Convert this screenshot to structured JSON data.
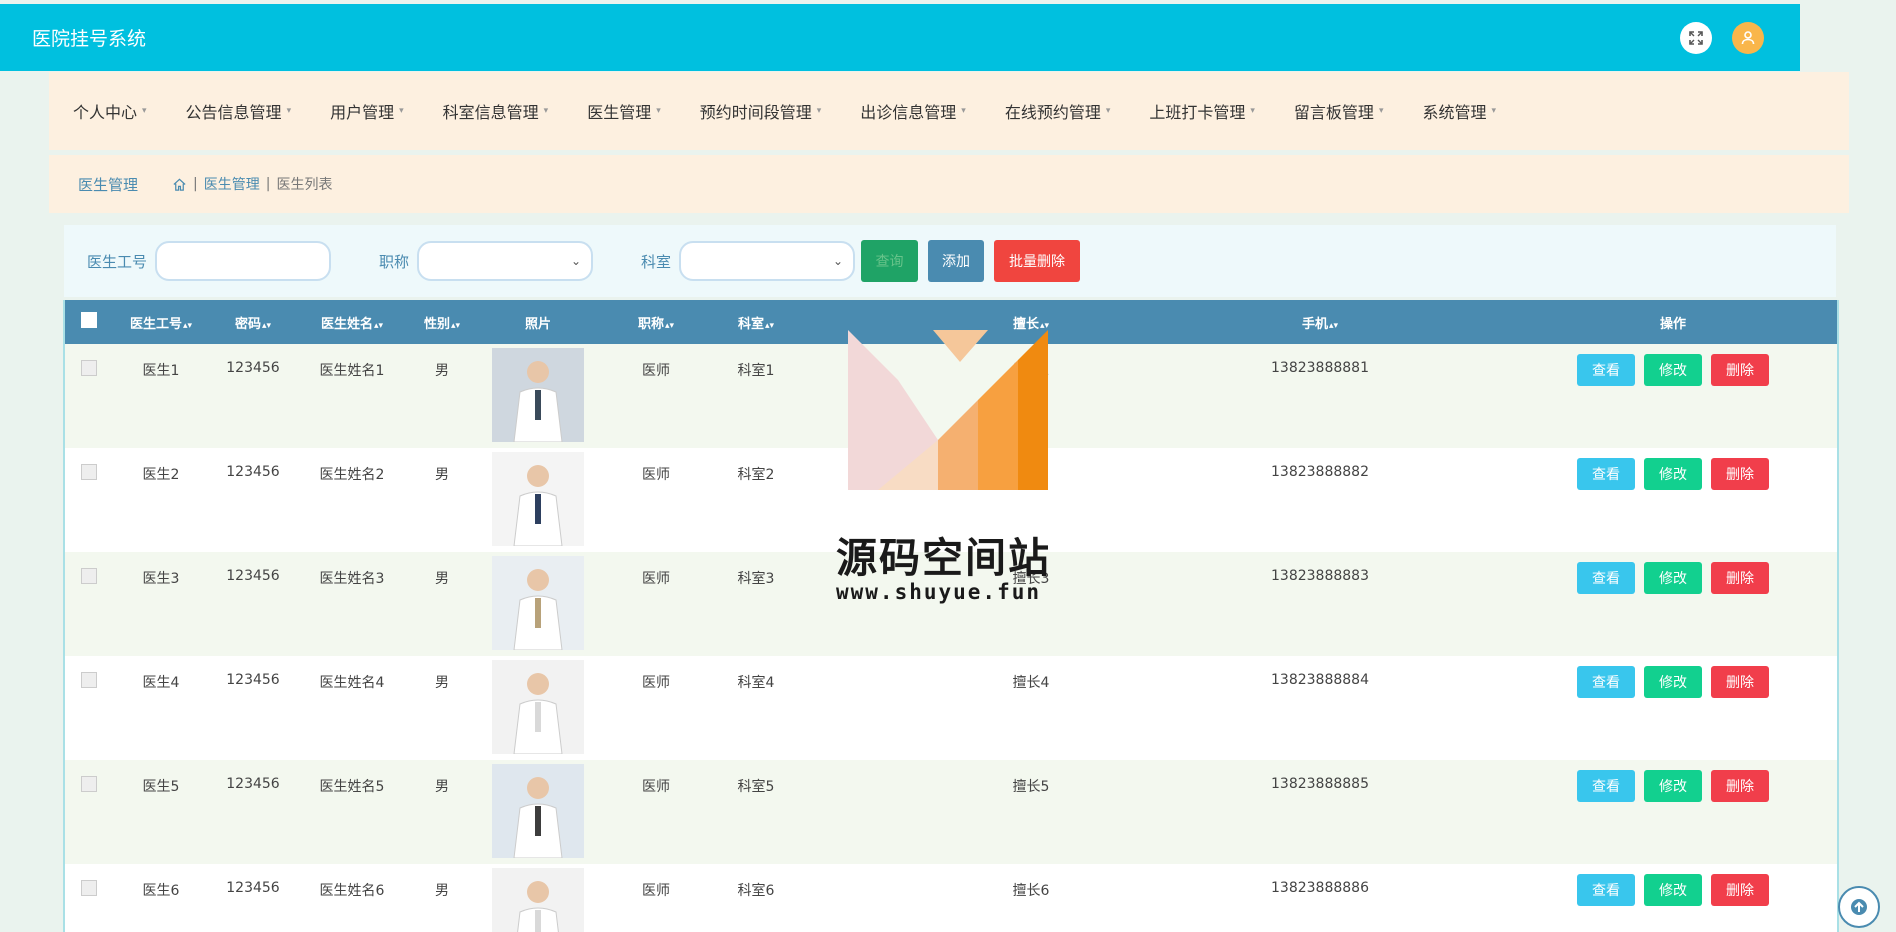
{
  "app": {
    "title": "医院挂号系统"
  },
  "menu": [
    {
      "label": "个人中心"
    },
    {
      "label": "公告信息管理"
    },
    {
      "label": "用户管理"
    },
    {
      "label": "科室信息管理"
    },
    {
      "label": "医生管理"
    },
    {
      "label": "预约时间段管理"
    },
    {
      "label": "出诊信息管理"
    },
    {
      "label": "在线预约管理"
    },
    {
      "label": "上班打卡管理"
    },
    {
      "label": "留言板管理"
    },
    {
      "label": "系统管理"
    }
  ],
  "breadcrumb": {
    "title": "医生管理",
    "sep": "|",
    "path1": "医生管理",
    "path2": "医生列表"
  },
  "search": {
    "label_id": "医生工号",
    "label_title": "职称",
    "label_dept": "科室",
    "search_btn": "查询",
    "add_btn": "添加",
    "batch_delete_btn": "批量删除"
  },
  "table": {
    "headers": {
      "id": "医生工号",
      "password": "密码",
      "name": "医生姓名",
      "gender": "性别",
      "photo": "照片",
      "title": "职称",
      "dept": "科室",
      "specialty": "擅长",
      "phone": "手机",
      "actions": "操作"
    },
    "actions": {
      "view": "查看",
      "edit": "修改",
      "delete": "删除"
    },
    "rows": [
      {
        "id": "医生1",
        "password": "123456",
        "name": "医生姓名1",
        "gender": "男",
        "title": "医师",
        "dept": "科室1",
        "specialty": "擅长1",
        "phone": "13823888881"
      },
      {
        "id": "医生2",
        "password": "123456",
        "name": "医生姓名2",
        "gender": "男",
        "title": "医师",
        "dept": "科室2",
        "specialty": "擅长2",
        "phone": "13823888882"
      },
      {
        "id": "医生3",
        "password": "123456",
        "name": "医生姓名3",
        "gender": "男",
        "title": "医师",
        "dept": "科室3",
        "specialty": "擅长3",
        "phone": "13823888883"
      },
      {
        "id": "医生4",
        "password": "123456",
        "name": "医生姓名4",
        "gender": "男",
        "title": "医师",
        "dept": "科室4",
        "specialty": "擅长4",
        "phone": "13823888884"
      },
      {
        "id": "医生5",
        "password": "123456",
        "name": "医生姓名5",
        "gender": "男",
        "title": "医师",
        "dept": "科室5",
        "specialty": "擅长5",
        "phone": "13823888885"
      },
      {
        "id": "医生6",
        "password": "123456",
        "name": "医生姓名6",
        "gender": "男",
        "title": "医师",
        "dept": "科室6",
        "specialty": "擅长6",
        "phone": "13823888886"
      }
    ]
  },
  "watermark": {
    "text": "源码空间站",
    "url": "www.shuyue.fun"
  },
  "colors": {
    "topbar": "#00c0df",
    "menubar": "#fdf0e0",
    "table_header": "#4a8bb0",
    "view": "#39c6ed",
    "edit": "#12d08f",
    "delete": "#f13e4b"
  },
  "icons": {
    "fullscreen": "fullscreen-icon",
    "user": "user-icon",
    "home": "home-icon",
    "back_to_top": "arrow-up-icon"
  }
}
